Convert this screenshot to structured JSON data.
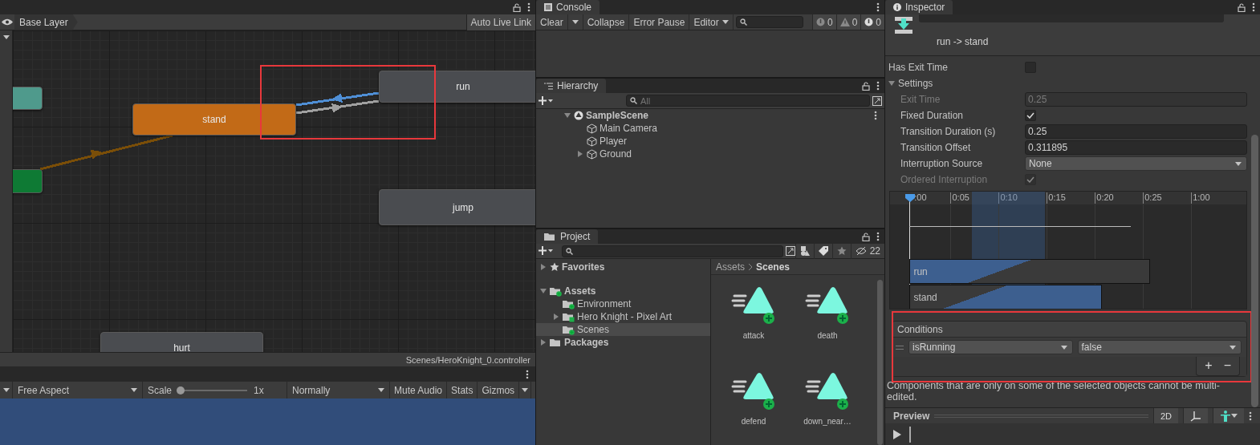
{
  "animator": {
    "breadcrumb": "Base Layer",
    "live_link_button": "Auto Live Link",
    "states": [
      {
        "color": "#4f9a8c"
      },
      {
        "color": "#0e7a34"
      },
      {
        "label": "stand",
        "color": "#c26a17"
      },
      {
        "label": "run",
        "color": "#4a4c50"
      },
      {
        "label": "jump",
        "color": "#4a4c50"
      },
      {
        "label": "hurt",
        "color": "#4a4c50"
      }
    ],
    "transitions": [
      {
        "color": "#7a4e08"
      },
      {
        "color": "#4f8fd6"
      },
      {
        "color": "#a0a0a0"
      }
    ],
    "controller_path": "Scenes/HeroKnight_0.controller"
  },
  "game_view": {
    "aspect": "Free Aspect",
    "scale_label": "Scale",
    "scale": {
      "level": 0
    },
    "scale_reading": "1x",
    "play_mode": "Normally",
    "buttons": [
      "Mute Audio",
      "Stats",
      "Gizmos"
    ]
  },
  "console": {
    "tab": "Console",
    "buttons": [
      "Clear",
      "Collapse",
      "Error Pause"
    ],
    "editor_dropdown": "Editor",
    "counts": [
      "0",
      "0",
      "0"
    ]
  },
  "hierarchy": {
    "tab": "Hierarchy",
    "search": {
      "placeholder": "All"
    },
    "tree": [
      {
        "label": "SampleScene",
        "kind": "scene",
        "expanded": true,
        "children": [
          {
            "label": "Main Camera",
            "kind": "object"
          },
          {
            "label": "Player",
            "kind": "object"
          },
          {
            "label": "Ground",
            "kind": "object",
            "expanded": false
          }
        ]
      }
    ]
  },
  "project": {
    "tab": "Project",
    "hidden_count": "22",
    "tree": [
      {
        "label": "Favorites",
        "kind": "favorites",
        "expanded": false,
        "selected": false
      },
      {
        "label": "Assets",
        "kind": "added_folder",
        "expanded": true,
        "selected": false,
        "children": [
          {
            "label": "Environment",
            "kind": "added_folder",
            "selected": false
          },
          {
            "label": "Hero Knight - Pixel Art",
            "kind": "changed_folder",
            "expanded": false,
            "selected": false
          },
          {
            "label": "Scenes",
            "kind": "added_folder",
            "selected": true
          }
        ]
      },
      {
        "label": "Packages",
        "kind": "folder",
        "expanded": false,
        "selected": false
      }
    ],
    "path": [
      "Assets",
      "Scenes"
    ],
    "assets": [
      "attack",
      "death",
      "defend",
      "down_near…"
    ]
  },
  "inspector": {
    "tab": "Inspector",
    "title": "run -> stand",
    "has_exit_time": {
      "label": "Has Exit Time",
      "checked": false
    },
    "settings": {
      "label": "Settings",
      "expanded": true,
      "fields": [
        {
          "kind": "number",
          "label": "Exit Time",
          "value": "0.25",
          "disabled": true
        },
        {
          "kind": "checkbox",
          "label": "Fixed Duration",
          "checked": true,
          "disabled": false
        },
        {
          "kind": "number",
          "label": "Transition Duration (s)",
          "value": "0.25",
          "disabled": false
        },
        {
          "kind": "number",
          "label": "Transition Offset",
          "value": "0.311895",
          "disabled": false
        },
        {
          "kind": "dropdown",
          "label": "Interruption Source",
          "value": "None",
          "disabled": false
        },
        {
          "kind": "checkbox",
          "label": "Ordered Interruption",
          "checked": true,
          "disabled": true
        }
      ]
    },
    "timeline": {
      "ticks": [
        ":00",
        "0:05",
        "0:10",
        "0:15",
        "0:20",
        "0:25",
        "1:00"
      ],
      "clips": [
        "run",
        "stand"
      ]
    },
    "conditions": {
      "title": "Conditions",
      "items": [
        {
          "parameter": "isRunning",
          "value": "false"
        }
      ],
      "add_button": "+",
      "remove_button": "−"
    },
    "message": "Components that are only on some of the selected objects cannot be multi-edited.",
    "preview": {
      "title": "Preview",
      "mode_button": "2D"
    }
  }
}
